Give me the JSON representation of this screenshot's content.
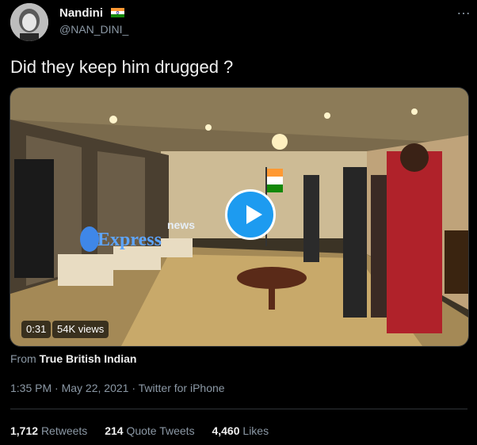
{
  "user": {
    "name": "Nandini",
    "handle": "@NAN_DINI_",
    "flag_icon": "india-flag-icon"
  },
  "more_label": "…",
  "tweet": {
    "text": "Did they keep him drugged ?"
  },
  "video": {
    "duration": "0:31",
    "views": "54K views",
    "watermark_top": "news",
    "watermark_brand": "Express"
  },
  "source": {
    "prefix": "From",
    "name": "True British Indian"
  },
  "meta": {
    "time": "1:35 PM",
    "separator": " · ",
    "date": "May 22, 2021",
    "client": "Twitter for iPhone"
  },
  "stats": {
    "retweets_count": "1,712",
    "retweets_label": "Retweets",
    "quotes_count": "214",
    "quotes_label": "Quote Tweets",
    "likes_count": "4,460",
    "likes_label": "Likes"
  },
  "colors": {
    "accent": "#1d9bf0",
    "background": "#000000",
    "secondary_text": "#8b98a5"
  }
}
